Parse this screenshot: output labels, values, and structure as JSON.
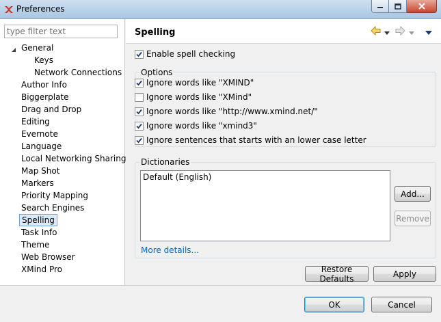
{
  "window": {
    "title": "Preferences",
    "controls": [
      "minimize",
      "maximize",
      "close"
    ]
  },
  "filter": {
    "placeholder": "type filter text",
    "value": ""
  },
  "tree": {
    "items": [
      {
        "label": "General",
        "level": 0,
        "expanded": true
      },
      {
        "label": "Keys",
        "level": 1
      },
      {
        "label": "Network Connections",
        "level": 1
      },
      {
        "label": "Author Info",
        "level": 0
      },
      {
        "label": "Biggerplate",
        "level": 0
      },
      {
        "label": "Drag and Drop",
        "level": 0
      },
      {
        "label": "Editing",
        "level": 0
      },
      {
        "label": "Evernote",
        "level": 0
      },
      {
        "label": "Language",
        "level": 0
      },
      {
        "label": "Local Networking Sharing",
        "level": 0
      },
      {
        "label": "Map Shot",
        "level": 0
      },
      {
        "label": "Markers",
        "level": 0
      },
      {
        "label": "Priority Mapping",
        "level": 0
      },
      {
        "label": "Search Engines",
        "level": 0
      },
      {
        "label": "Spelling",
        "level": 0,
        "selected": true
      },
      {
        "label": "Task Info",
        "level": 0
      },
      {
        "label": "Theme",
        "level": 0
      },
      {
        "label": "Web Browser",
        "level": 0
      },
      {
        "label": "XMind Pro",
        "level": 0
      }
    ]
  },
  "page": {
    "title": "Spelling",
    "nav_icons": [
      "back-arrow-icon",
      "back-dropdown-icon",
      "forward-arrow-icon",
      "forward-dropdown-icon",
      "view-menu-icon"
    ],
    "enable": {
      "label": "Enable spell checking",
      "checked": true
    },
    "options": {
      "label": "Options",
      "items": [
        {
          "label": "Ignore words like \"XMIND\"",
          "checked": true
        },
        {
          "label": "Ignore words like \"XMind\"",
          "checked": false
        },
        {
          "label": "Ignore words like \"http://www.xmind.net/\"",
          "checked": true
        },
        {
          "label": "Ignore words like \"xmind3\"",
          "checked": true
        },
        {
          "label": "Ignore sentences that starts with an lower case letter",
          "checked": true
        }
      ]
    },
    "dictionaries": {
      "label": "Dictionaries",
      "entries": [
        "Default (English)"
      ],
      "add_label": "Add...",
      "remove_label": "Remove",
      "more_details": "More details..."
    },
    "restore_defaults": "Restore Defaults",
    "apply": "Apply"
  },
  "footer": {
    "ok": "OK",
    "cancel": "Cancel"
  },
  "colors": {
    "link": "#0066cc",
    "selection": "#dceaf8",
    "titlebar": "#bcd4ea"
  }
}
